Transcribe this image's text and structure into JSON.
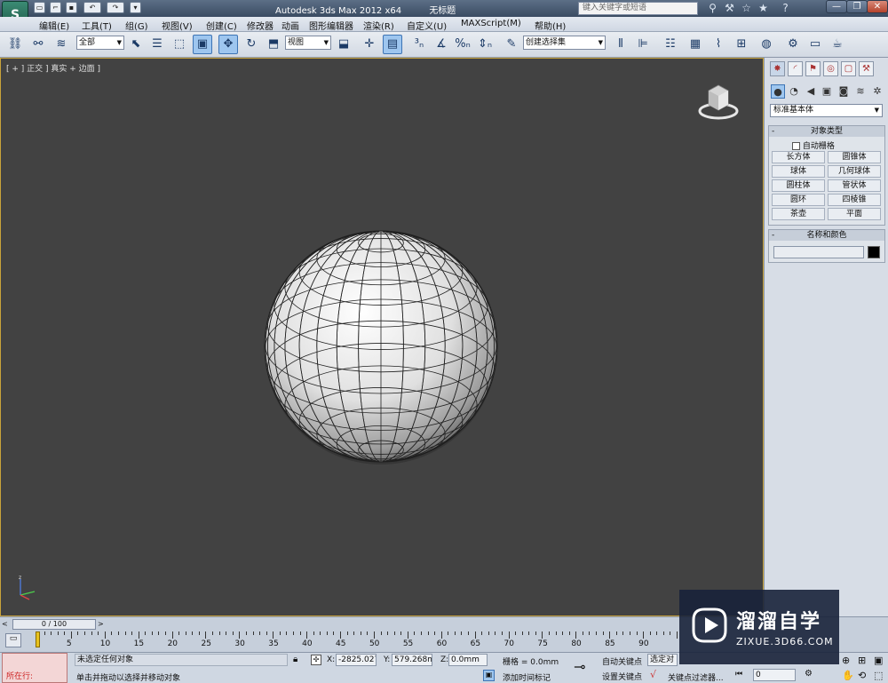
{
  "app": {
    "logo_text": "S",
    "title": "Autodesk 3ds Max  2012 x64",
    "doc_title": "无标题"
  },
  "quick_access": [
    "new-icon",
    "open-icon",
    "save-icon",
    "undo-icon",
    "redo-icon",
    "dropdown-icon"
  ],
  "search": {
    "placeholder": "键入关键字或短语"
  },
  "title_icons": [
    "binoculars-icon",
    "wrench-icon",
    "star-icon",
    "help-icon"
  ],
  "window_controls": {
    "minimize": "—",
    "restore": "❐",
    "close": "✕"
  },
  "menu": [
    "编辑(E)",
    "工具(T)",
    "组(G)",
    "视图(V)",
    "创建(C)",
    "修改器",
    "动画",
    "图形编辑器",
    "渲染(R)",
    "自定义(U)",
    "MAXScript(M)",
    "帮助(H)"
  ],
  "toolbar": {
    "filter": "全部",
    "coord": "视图",
    "selset": "创建选择集"
  },
  "viewport": {
    "label": "[ + ] 正交 ] 真实 + 边面 ]",
    "axis_z": "z",
    "axis_x": "x",
    "accent": "#c9a33a"
  },
  "command_panel": {
    "category": "标准基本体",
    "rollout1": {
      "title": "对象类型",
      "autogrid": "自动栅格",
      "buttons": [
        "长方体",
        "圆锥体",
        "球体",
        "几何球体",
        "圆柱体",
        "管状体",
        "圆环",
        "四棱锥",
        "茶壶",
        "平面"
      ]
    },
    "rollout2": {
      "title": "名称和颜色",
      "name_value": "",
      "color": "#000000"
    }
  },
  "timeline": {
    "slider": "0 / 100",
    "ticks": [
      "5",
      "10",
      "15",
      "20",
      "25",
      "30",
      "35",
      "40",
      "45",
      "50",
      "55",
      "60",
      "65",
      "70",
      "75",
      "80",
      "85",
      "90"
    ]
  },
  "status": {
    "running": "所在行:",
    "selection": "未选定任何对象",
    "prompt": "单击并拖动以选择并移动对象",
    "x_label": "X:",
    "x_value": "-2825.027",
    "y_label": "Y:",
    "y_value": "579.268mm",
    "z_label": "Z:",
    "z_value": "0.0mm",
    "grid": "栅格 = 0.0mm",
    "add_time_tag": "添加时间标记",
    "auto_key": "自动关键点",
    "set_key": "设置关键点",
    "selected_dd": "选定对象",
    "key_filters": "关键点过滤器...",
    "frame": "0"
  },
  "watermark": {
    "name": "溜溜自学",
    "url": "ZIXUE.3D66.COM"
  }
}
